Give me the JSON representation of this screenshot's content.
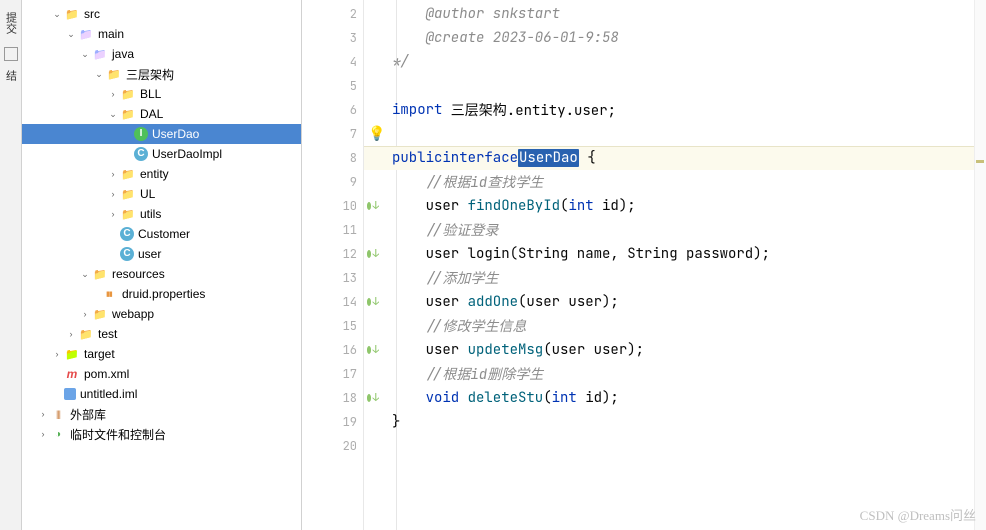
{
  "leftTab": {
    "label": "结"
  },
  "tree": [
    {
      "depth": 2,
      "arrow": "v",
      "icon": "folder",
      "label": "src"
    },
    {
      "depth": 3,
      "arrow": "v",
      "icon": "folder-blue",
      "label": "main"
    },
    {
      "depth": 4,
      "arrow": "v",
      "icon": "folder-blue",
      "label": "java"
    },
    {
      "depth": 5,
      "arrow": "v",
      "icon": "folder",
      "label": "三层架构"
    },
    {
      "depth": 6,
      "arrow": ">",
      "icon": "folder",
      "label": "BLL"
    },
    {
      "depth": 6,
      "arrow": "v",
      "icon": "folder",
      "label": "DAL"
    },
    {
      "depth": 7,
      "arrow": "",
      "icon": "i",
      "label": "UserDao",
      "selected": true
    },
    {
      "depth": 7,
      "arrow": "",
      "icon": "c",
      "label": "UserDaoImpl"
    },
    {
      "depth": 6,
      "arrow": ">",
      "icon": "folder",
      "label": "entity"
    },
    {
      "depth": 6,
      "arrow": ">",
      "icon": "folder",
      "label": "UL"
    },
    {
      "depth": 6,
      "arrow": ">",
      "icon": "folder",
      "label": "utils"
    },
    {
      "depth": 6,
      "arrow": "",
      "icon": "c",
      "label": "Customer"
    },
    {
      "depth": 6,
      "arrow": "",
      "icon": "c",
      "label": "user"
    },
    {
      "depth": 4,
      "arrow": "v",
      "icon": "folder",
      "label": "resources"
    },
    {
      "depth": 5,
      "arrow": "",
      "icon": "prop",
      "label": "druid.properties"
    },
    {
      "depth": 4,
      "arrow": ">",
      "icon": "folder",
      "label": "webapp"
    },
    {
      "depth": 3,
      "arrow": ">",
      "icon": "folder",
      "label": "test"
    },
    {
      "depth": 2,
      "arrow": ">",
      "icon": "folder-orange",
      "label": "target"
    },
    {
      "depth": 2,
      "arrow": "",
      "icon": "m",
      "label": "pom.xml"
    },
    {
      "depth": 2,
      "arrow": "",
      "icon": "xml",
      "label": "untitled.iml"
    },
    {
      "depth": 1,
      "arrow": ">",
      "icon": "lib",
      "label": "外部库"
    },
    {
      "depth": 1,
      "arrow": ">",
      "icon": "temp",
      "label": "临时文件和控制台"
    }
  ],
  "gutter": [
    {
      "n": 2,
      "mark": ""
    },
    {
      "n": 3,
      "mark": ""
    },
    {
      "n": 4,
      "mark": ""
    },
    {
      "n": 5,
      "mark": ""
    },
    {
      "n": 6,
      "mark": ""
    },
    {
      "n": 7,
      "mark": ""
    },
    {
      "n": 8,
      "mark": "green-arrow"
    },
    {
      "n": 9,
      "mark": ""
    },
    {
      "n": 10,
      "mark": "green-arrow"
    },
    {
      "n": 11,
      "mark": ""
    },
    {
      "n": 12,
      "mark": "green-arrow"
    },
    {
      "n": 13,
      "mark": ""
    },
    {
      "n": 14,
      "mark": "green-arrow"
    },
    {
      "n": 15,
      "mark": ""
    },
    {
      "n": 16,
      "mark": "green-arrow"
    },
    {
      "n": 17,
      "mark": ""
    },
    {
      "n": 18,
      "mark": "green-arrow"
    },
    {
      "n": 19,
      "mark": ""
    },
    {
      "n": 20,
      "mark": ""
    }
  ],
  "code": {
    "l2": "    @author snkstart",
    "l3": "    @create 2023-06-01-9:58",
    "l4": "*/",
    "l6_kw": "import",
    "l6_txt": " 三层架构.entity.user;",
    "l8_p": "public",
    "l8_i": "interface",
    "l8_name": "UserDao",
    "l8_b": " {",
    "l9": "    //根据id查找学生",
    "l10_t": "    user ",
    "l10_m": "findOneById",
    "l10_p1": "(",
    "l10_kw": "int",
    "l10_p2": " id);",
    "l11": "    //验证登录",
    "l12": "    user login(String name, String password);",
    "l13": "    //添加学生",
    "l14_t": "    user ",
    "l14_m": "addOne",
    "l14_p": "(user user);",
    "l15": "    //修改学生信息",
    "l16_t": "    user ",
    "l16_m": "updeteMsg",
    "l16_p": "(user user);",
    "l17": "    //根据id删除学生",
    "l18_kw": "    void ",
    "l18_m": "deleteStu",
    "l18_p1": "(",
    "l18_kw2": "int",
    "l18_p2": " id);",
    "l19": "}"
  },
  "watermark": "CSDN @Dreams问丝"
}
